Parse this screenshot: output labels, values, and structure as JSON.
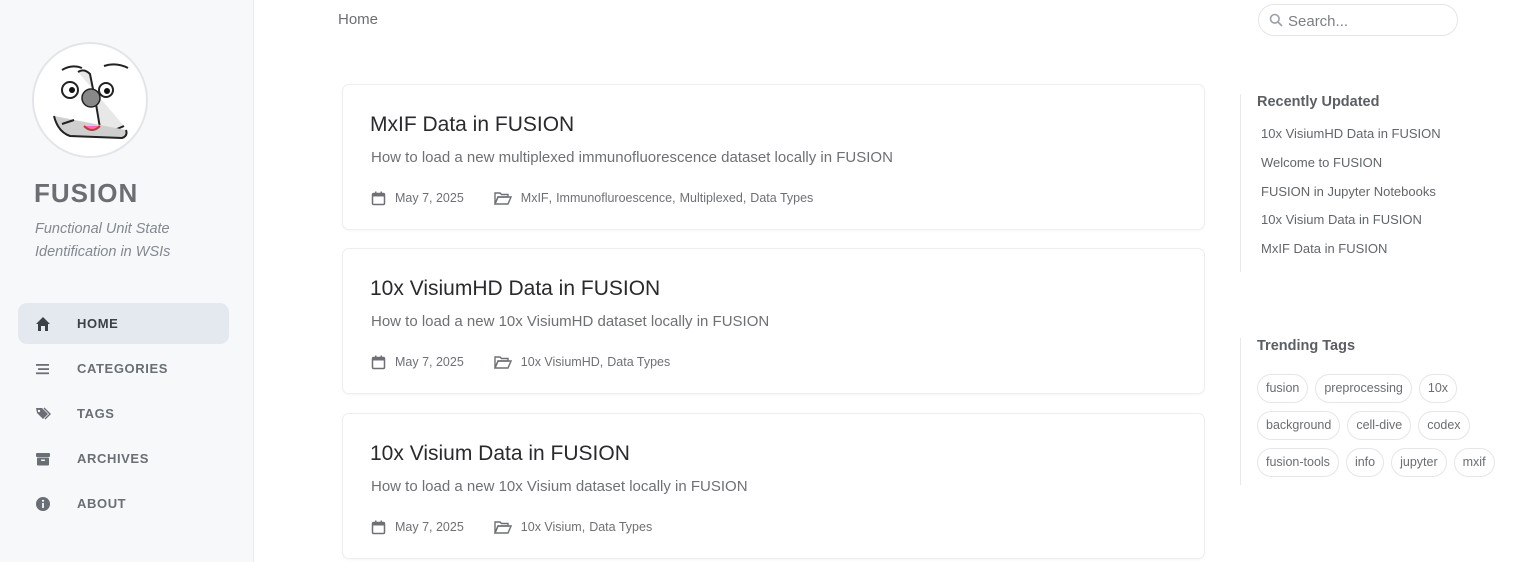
{
  "sidebar": {
    "title": "FUSION",
    "subtitle": "Functional Unit State Identification in WSIs",
    "nav": [
      {
        "label": "HOME",
        "icon": "home-icon",
        "active": true
      },
      {
        "label": "CATEGORIES",
        "icon": "stream-icon"
      },
      {
        "label": "TAGS",
        "icon": "tags-icon"
      },
      {
        "label": "ARCHIVES",
        "icon": "archive-icon"
      },
      {
        "label": "ABOUT",
        "icon": "info-icon"
      }
    ]
  },
  "topbar": {
    "breadcrumb": "Home",
    "search_placeholder": "Search..."
  },
  "posts": [
    {
      "title": "MxIF Data in FUSION",
      "description": "How to load a new multiplexed immunofluorescence dataset locally in FUSION",
      "date": "May 7, 2025",
      "categories": [
        "MxIF",
        "Immunofluroescence",
        "Multiplexed",
        "Data Types"
      ]
    },
    {
      "title": "10x VisiumHD Data in FUSION",
      "description": "How to load a new 10x VisiumHD dataset locally in FUSION",
      "date": "May 7, 2025",
      "categories": [
        "10x VisiumHD",
        "Data Types"
      ]
    },
    {
      "title": "10x Visium Data in FUSION",
      "description": "How to load a new 10x Visium dataset locally in FUSION",
      "date": "May 7, 2025",
      "categories": [
        "10x Visium",
        "Data Types"
      ]
    }
  ],
  "recently_updated": {
    "heading": "Recently Updated",
    "items": [
      "10x VisiumHD Data in FUSION",
      "Welcome to FUSION",
      "FUSION in Jupyter Notebooks",
      "10x Visium Data in FUSION",
      "MxIF Data in FUSION"
    ]
  },
  "trending_tags": {
    "heading": "Trending Tags",
    "tags": [
      "fusion",
      "preprocessing",
      "10x",
      "background",
      "cell-dive",
      "codex",
      "fusion-tools",
      "info",
      "jupyter",
      "mxif"
    ]
  },
  "colors": {
    "sidebar_bg": "#f6f8fa",
    "active_nav_bg": "#e4e9ef",
    "text": "#34343c"
  }
}
